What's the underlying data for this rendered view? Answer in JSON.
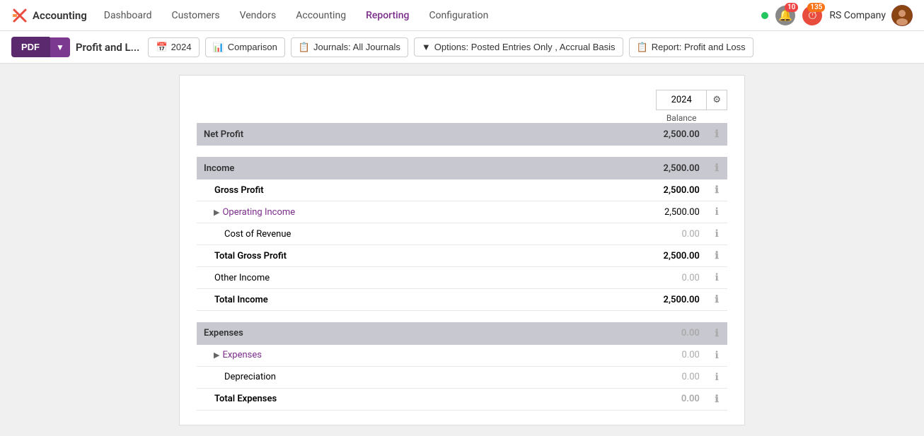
{
  "nav": {
    "logo_text": "Accounting",
    "items": [
      {
        "label": "Dashboard",
        "active": false
      },
      {
        "label": "Customers",
        "active": false
      },
      {
        "label": "Vendors",
        "active": false
      },
      {
        "label": "Accounting",
        "active": false
      },
      {
        "label": "Reporting",
        "active": true
      },
      {
        "label": "Configuration",
        "active": false
      }
    ],
    "status_color": "#22c55e",
    "notifications_count": "10",
    "timer_count": "135",
    "company_name": "RS Company"
  },
  "toolbar": {
    "pdf_label": "PDF",
    "page_title": "Profit and L...",
    "filters": [
      {
        "icon": "📅",
        "label": "2024"
      },
      {
        "icon": "📊",
        "label": "Comparison"
      },
      {
        "icon": "📋",
        "label": "Journals: All Journals"
      },
      {
        "icon": "🔽",
        "label": "Options: Posted Entries Only , Accrual Basis"
      },
      {
        "icon": "📋",
        "label": "Report: Profit and Loss"
      }
    ]
  },
  "report": {
    "year_col": "2024",
    "balance_label": "Balance",
    "sections": [
      {
        "type": "section_header",
        "label": "Net Profit",
        "amount": "2,500.00",
        "muted": false
      },
      {
        "type": "spacer"
      },
      {
        "type": "section_header",
        "label": "Income",
        "amount": "2,500.00",
        "muted": false
      },
      {
        "type": "data_row",
        "label": "Gross Profit",
        "amount": "2,500.00",
        "muted": false,
        "bold": true,
        "indent": 0,
        "expandable": false
      },
      {
        "type": "data_row",
        "label": "Operating Income",
        "amount": "2,500.00",
        "muted": false,
        "bold": false,
        "indent": 1,
        "expandable": true,
        "link": true
      },
      {
        "type": "data_row",
        "label": "Cost of Revenue",
        "amount": "0.00",
        "muted": true,
        "bold": false,
        "indent": 1,
        "expandable": false
      },
      {
        "type": "data_row",
        "label": "Total Gross Profit",
        "amount": "2,500.00",
        "muted": false,
        "bold": true,
        "indent": 0,
        "expandable": false
      },
      {
        "type": "data_row",
        "label": "Other Income",
        "amount": "0.00",
        "muted": true,
        "bold": false,
        "indent": 0,
        "expandable": false
      },
      {
        "type": "data_row",
        "label": "Total Income",
        "amount": "2,500.00",
        "muted": false,
        "bold": true,
        "indent": 0,
        "expandable": false
      },
      {
        "type": "spacer"
      },
      {
        "type": "section_header",
        "label": "Expenses",
        "amount": "0.00",
        "muted": true
      },
      {
        "type": "data_row",
        "label": "Expenses",
        "amount": "0.00",
        "muted": true,
        "bold": false,
        "indent": 1,
        "expandable": true,
        "link": true
      },
      {
        "type": "data_row",
        "label": "Depreciation",
        "amount": "0.00",
        "muted": true,
        "bold": false,
        "indent": 1,
        "expandable": false
      },
      {
        "type": "data_row",
        "label": "Total Expenses",
        "amount": "0.00",
        "muted": true,
        "bold": true,
        "indent": 0,
        "expandable": false
      }
    ]
  }
}
